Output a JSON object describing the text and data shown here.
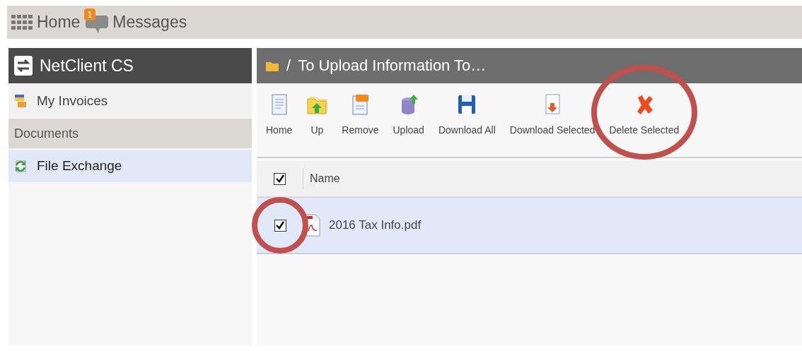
{
  "top_bar": {
    "home": "Home",
    "messages": {
      "label": "Messages",
      "badge": "1"
    }
  },
  "sidebar": {
    "title": "NetClient CS",
    "items": [
      {
        "kind": "link",
        "label": "My Invoices",
        "selected": false
      },
      {
        "kind": "section",
        "label": "Documents"
      },
      {
        "kind": "link",
        "label": "File Exchange",
        "selected": true
      }
    ]
  },
  "panel": {
    "separator": "/",
    "title": "To Upload Information To…",
    "toolbar": [
      {
        "kind": "home",
        "label": "Home",
        "circled": false
      },
      {
        "kind": "up",
        "label": "Up",
        "circled": false
      },
      {
        "kind": "remove",
        "label": "Remove",
        "circled": false
      },
      {
        "kind": "upload",
        "label": "Upload",
        "circled": false
      },
      {
        "kind": "download-all",
        "label": "Download All",
        "circled": false
      },
      {
        "kind": "download-selected",
        "label": "Download Selected",
        "circled": false
      },
      {
        "kind": "delete",
        "label": "Delete Selected",
        "circled": true
      }
    ],
    "table": {
      "columns": [
        "Name"
      ],
      "header_checked": true,
      "rows": [
        {
          "name": "2016 Tax Info.pdf",
          "checked": true,
          "selected": true,
          "checkbox_circled": true
        }
      ]
    }
  }
}
